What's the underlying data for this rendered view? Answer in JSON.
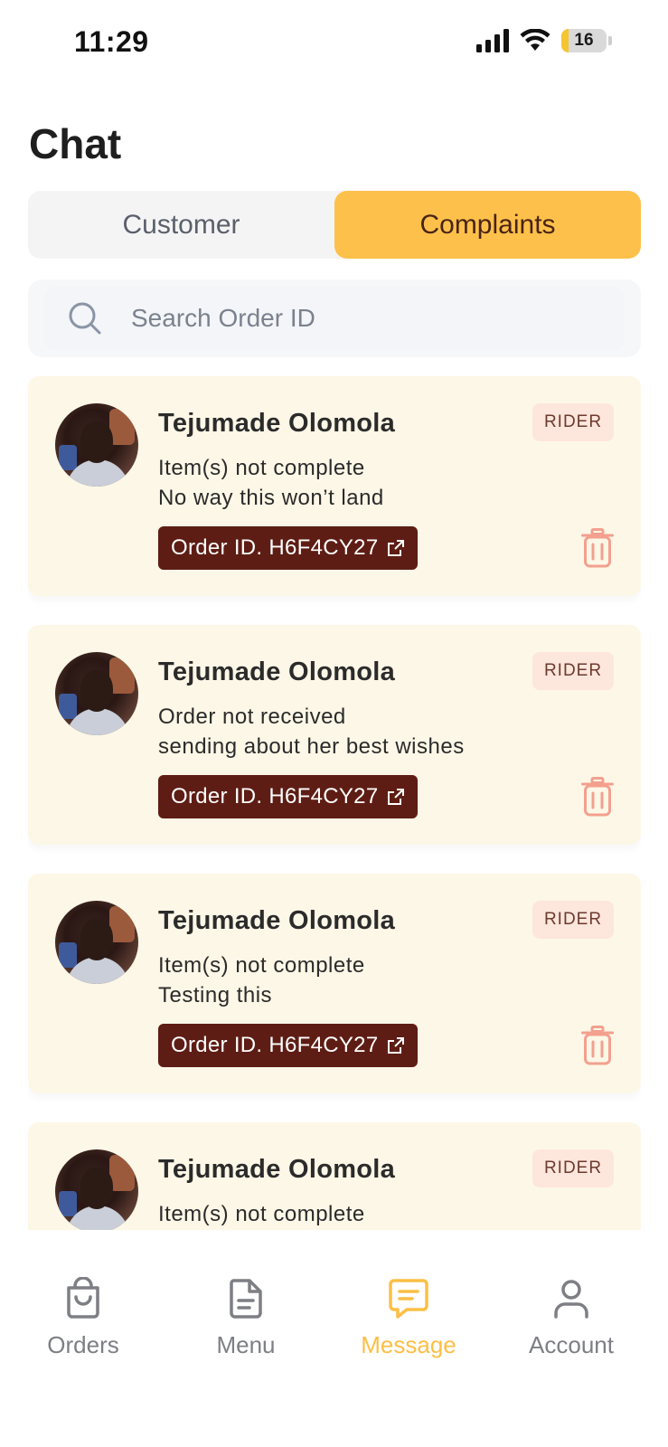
{
  "status_bar": {
    "time": "11:29",
    "battery": "16",
    "battery_level": 0.16
  },
  "page": {
    "title": "Chat"
  },
  "tabs": [
    {
      "label": "Customer",
      "active": false
    },
    {
      "label": "Complaints",
      "active": true
    }
  ],
  "search": {
    "placeholder": "Search Order ID"
  },
  "complaints": [
    {
      "name": "Tejumade Olomola",
      "badge": "RIDER",
      "line1": "Item(s) not complete",
      "line2": "No way this won’t land",
      "order": "Order ID. H6F4CY27"
    },
    {
      "name": "Tejumade Olomola",
      "badge": "RIDER",
      "line1": "Order not received",
      "line2": "sending about her best wishes",
      "order": "Order ID. H6F4CY27"
    },
    {
      "name": "Tejumade Olomola",
      "badge": "RIDER",
      "line1": "Item(s) not complete",
      "line2": "Testing this",
      "order": "Order ID. H6F4CY27"
    },
    {
      "name": "Tejumade Olomola",
      "badge": "RIDER",
      "line1": "Item(s) not complete",
      "line2": "",
      "order": ""
    }
  ],
  "nav": [
    {
      "label": "Orders",
      "icon": "bag-icon",
      "active": false
    },
    {
      "label": "Menu",
      "icon": "document-icon",
      "active": false
    },
    {
      "label": "Message",
      "icon": "message-icon",
      "active": true
    },
    {
      "label": "Account",
      "icon": "user-icon",
      "active": false
    }
  ],
  "colors": {
    "accent": "#fdc14b",
    "card_bg": "#fdf7e7",
    "order_button": "#5e1d14",
    "badge_bg": "#fde6dc",
    "trash": "#f3a08f",
    "nav_active": "#fcbf45"
  }
}
